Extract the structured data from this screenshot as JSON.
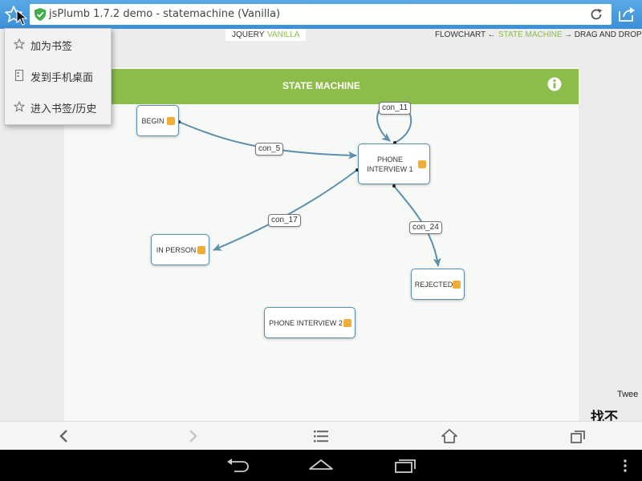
{
  "browser": {
    "url_title": "jsPlumb 1.7.2 demo - statemachine (Vanilla)",
    "icons": {
      "bookmark_star": "star-outline-icon",
      "secure": "shield-check-icon",
      "reload": "reload-icon",
      "share": "share-icon"
    },
    "bottom_bar": [
      "back-icon",
      "forward-icon",
      "menu-list-icon",
      "home-icon",
      "tabs-icon"
    ]
  },
  "popup_menu": {
    "items": [
      {
        "label": "加为书签",
        "icon": "star-outline-icon"
      },
      {
        "label": "发到手机桌面",
        "icon": "phone-desktop-icon"
      },
      {
        "label": "进入书签/历史",
        "icon": "star-outline-icon"
      }
    ]
  },
  "demo_nav": {
    "libraries": [
      {
        "label": "JQUERY",
        "active": false
      },
      {
        "label": "VANILLA",
        "active": true
      }
    ],
    "demos": [
      {
        "label": "FLOWCHART",
        "arrow": "left"
      },
      {
        "label": "STATE MACHINE",
        "active": true
      },
      {
        "label": "DRAG AND DROP",
        "arrow": "right"
      }
    ]
  },
  "header": {
    "title": "STATE MACHINE",
    "info_icon": "info-circle-icon"
  },
  "nodes": [
    {
      "id": "begin",
      "label": "BEGIN"
    },
    {
      "id": "phone1",
      "label": "PHONE INTERVIEW 1",
      "line1": "PHONE",
      "line2": "INTERVIEW 1"
    },
    {
      "id": "inperson",
      "label": "IN PERSON"
    },
    {
      "id": "rejected",
      "label": "REJECTED"
    },
    {
      "id": "phone2",
      "label": "PHONE INTERVIEW 2"
    }
  ],
  "connections": [
    {
      "label": "con_5",
      "from": "begin",
      "to": "phone1"
    },
    {
      "label": "con_11",
      "from": "phone1",
      "to": "phone1"
    },
    {
      "label": "con_17",
      "from": "phone1",
      "to": "inperson"
    },
    {
      "label": "con_24",
      "from": "phone1",
      "to": "rejected"
    }
  ],
  "side_text": {
    "tweet": "Twee",
    "not_found": "找不"
  },
  "colors": {
    "accent_green": "#8cbc4a",
    "connector": "#5b90ab",
    "endpoint": "#f0ad38",
    "browser_blue": "#3b8fd6"
  },
  "android_nav": [
    "back-icon",
    "home-icon",
    "recents-icon",
    "overflow-icon"
  ]
}
